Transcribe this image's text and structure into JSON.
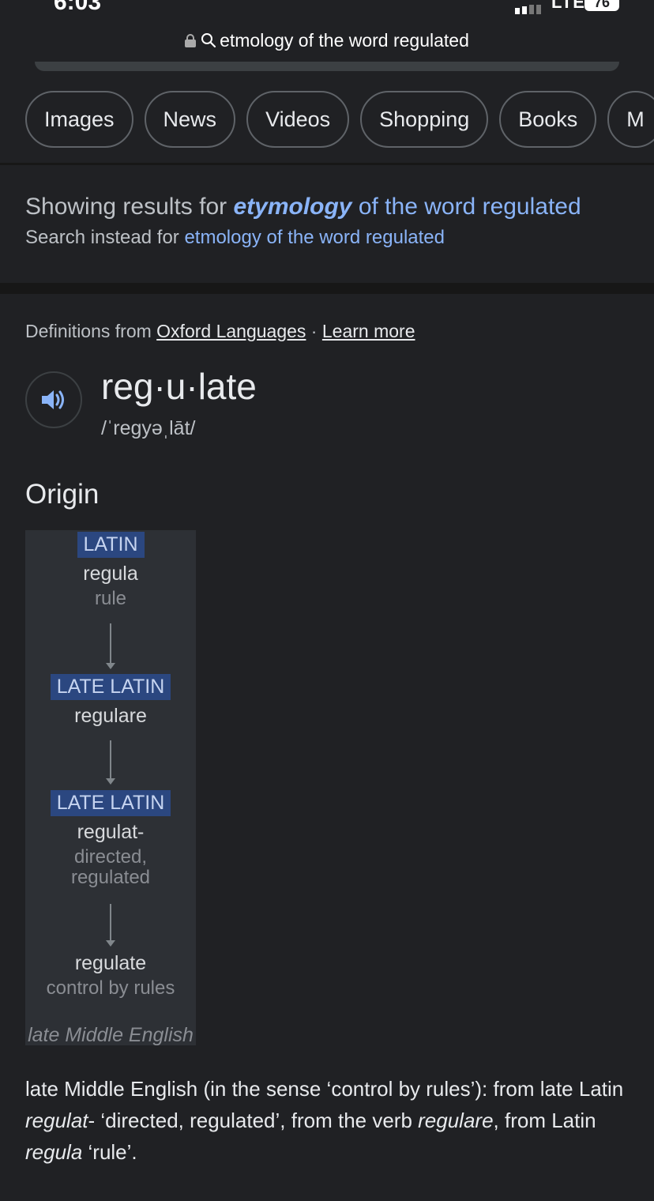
{
  "status": {
    "time": "6:03",
    "network": "LTE",
    "battery": "76"
  },
  "url": {
    "query": "etmology of the word regulated"
  },
  "chips": [
    "Images",
    "News",
    "Videos",
    "Shopping",
    "Books",
    "M"
  ],
  "spelling": {
    "prefix": "Showing results for ",
    "corrected_word": "etymology",
    "corrected_rest": " of the word regulated",
    "instead_prefix": "Search instead for ",
    "instead_query": "etmology of the word regulated"
  },
  "definition": {
    "source_prefix": "Definitions from ",
    "source_link": "Oxford Languages",
    "dot": " · ",
    "learn_more": "Learn more",
    "word": "reg·u·late",
    "pronunciation": "/ˈregyəˌlāt/",
    "origin_heading": "Origin"
  },
  "etymology": {
    "nodes": [
      {
        "lang": "LATIN",
        "word": "regula",
        "gloss": "rule"
      },
      {
        "lang": "LATE LATIN",
        "word": "regulare",
        "gloss": ""
      },
      {
        "lang": "LATE LATIN",
        "word": "regulat-",
        "gloss1": "directed,",
        "gloss2": "regulated"
      },
      {
        "lang": "",
        "word": "regulate",
        "gloss": "control by rules"
      }
    ],
    "footer": "late Middle English"
  },
  "description": {
    "p1": "late Middle English (in the sense ‘control by rules’): from late Latin ",
    "i1": "regulat",
    "p2": "- ‘directed, regulated’, from the verb ",
    "i2": "regulare",
    "p3": ", from Latin ",
    "i3": "regula",
    "p4": " ‘rule’."
  }
}
